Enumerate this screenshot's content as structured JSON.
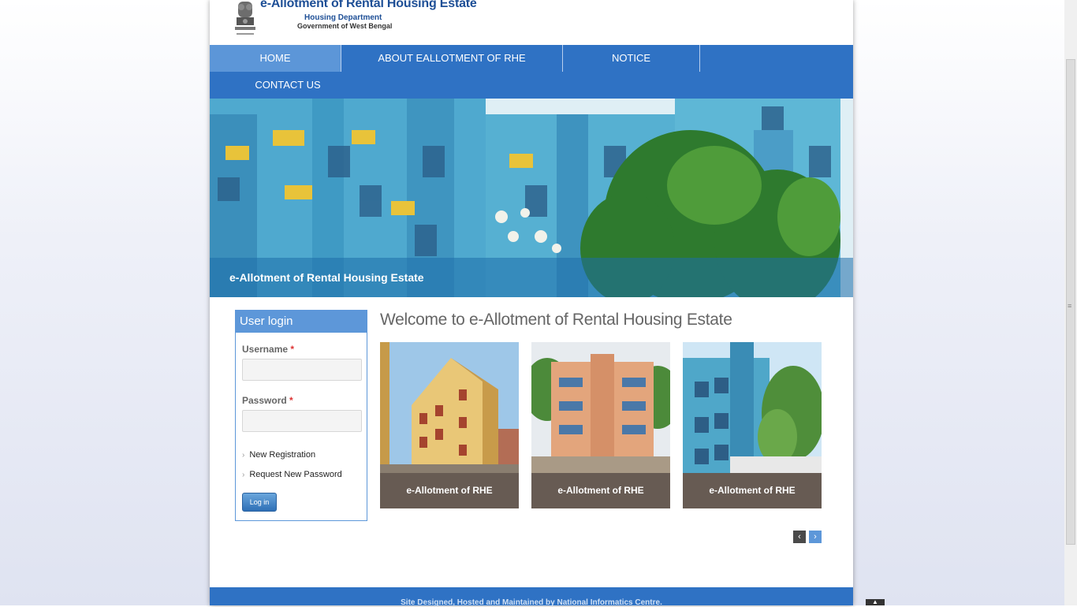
{
  "header": {
    "title": "e-Allotment of Rental Housing Estate",
    "department": "Housing Department",
    "government": "Government of West Bengal"
  },
  "nav": {
    "items": [
      "HOME",
      "ABOUT EALLOTMENT OF RHE",
      "NOTICE",
      "CONTACT US"
    ],
    "active": "HOME"
  },
  "banner": {
    "caption": "e-Allotment of Rental Housing Estate"
  },
  "login": {
    "heading": "User login",
    "username_label": "Username",
    "password_label": "Password",
    "required_marker": "*",
    "username_value": "",
    "password_value": "",
    "links": [
      "New Registration",
      "Request New Password"
    ],
    "button": "Log in"
  },
  "main": {
    "welcome": "Welcome to e-Allotment of Rental Housing Estate",
    "cards": [
      {
        "label": "e-Allotment of RHE"
      },
      {
        "label": "e-Allotment of RHE"
      },
      {
        "label": "e-Allotment of RHE"
      }
    ]
  },
  "pager": {
    "prev_icon": "‹",
    "next_icon": "›"
  },
  "footer": {
    "text": "Site Designed, Hosted and Maintained by National Informatics Centre."
  },
  "colors": {
    "nav_blue": "#2f72c4",
    "nav_active": "#5c96d8",
    "card_footer": "#675b53",
    "login_border": "#5d97d9"
  },
  "icons": [
    "state-emblem-icon",
    "chevron-right-icon",
    "chevron-left-icon",
    "scroll-to-top-icon"
  ]
}
